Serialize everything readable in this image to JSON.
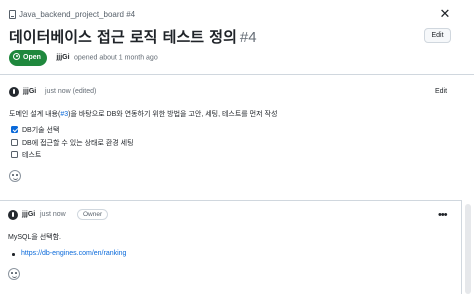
{
  "header": {
    "board_label": "Java_backend_project_board #4",
    "board_icon": "project-board-icon",
    "close_icon": "close-icon"
  },
  "issue": {
    "title": "데이터베이스 접근 로직 테스트 정의",
    "number": "#4",
    "edit_label": "Edit",
    "state": "Open",
    "author": "jjjGi",
    "opened_text": "opened about 1 month ago"
  },
  "comments": [
    {
      "author": "jjjGi",
      "time": "just now (edited)",
      "edit_label": "Edit",
      "body_prefix": "도메인 설계 내용(",
      "body_link": "#3",
      "body_suffix": ")을 바탕으로 DB와 연동하기 위한 방법을 고안, 세팅, 테스트를 먼저 작성",
      "tasks": [
        {
          "label": "DB기술 선택",
          "checked": true
        },
        {
          "label": "DB에 접근할 수 있는 상태로 환경 세팅",
          "checked": false
        },
        {
          "label": "테스트",
          "checked": false
        }
      ]
    },
    {
      "author": "jjjGi",
      "time": "just now",
      "badge": "Owner",
      "body": "MySQL을 선택함.",
      "link": "https://db-engines.com/en/ranking",
      "more_icon": "kebab-menu-icon"
    }
  ],
  "colors": {
    "open_green": "#1f883d",
    "link_blue": "#0969da",
    "border": "#d0d7de",
    "muted_text": "#656d76"
  }
}
